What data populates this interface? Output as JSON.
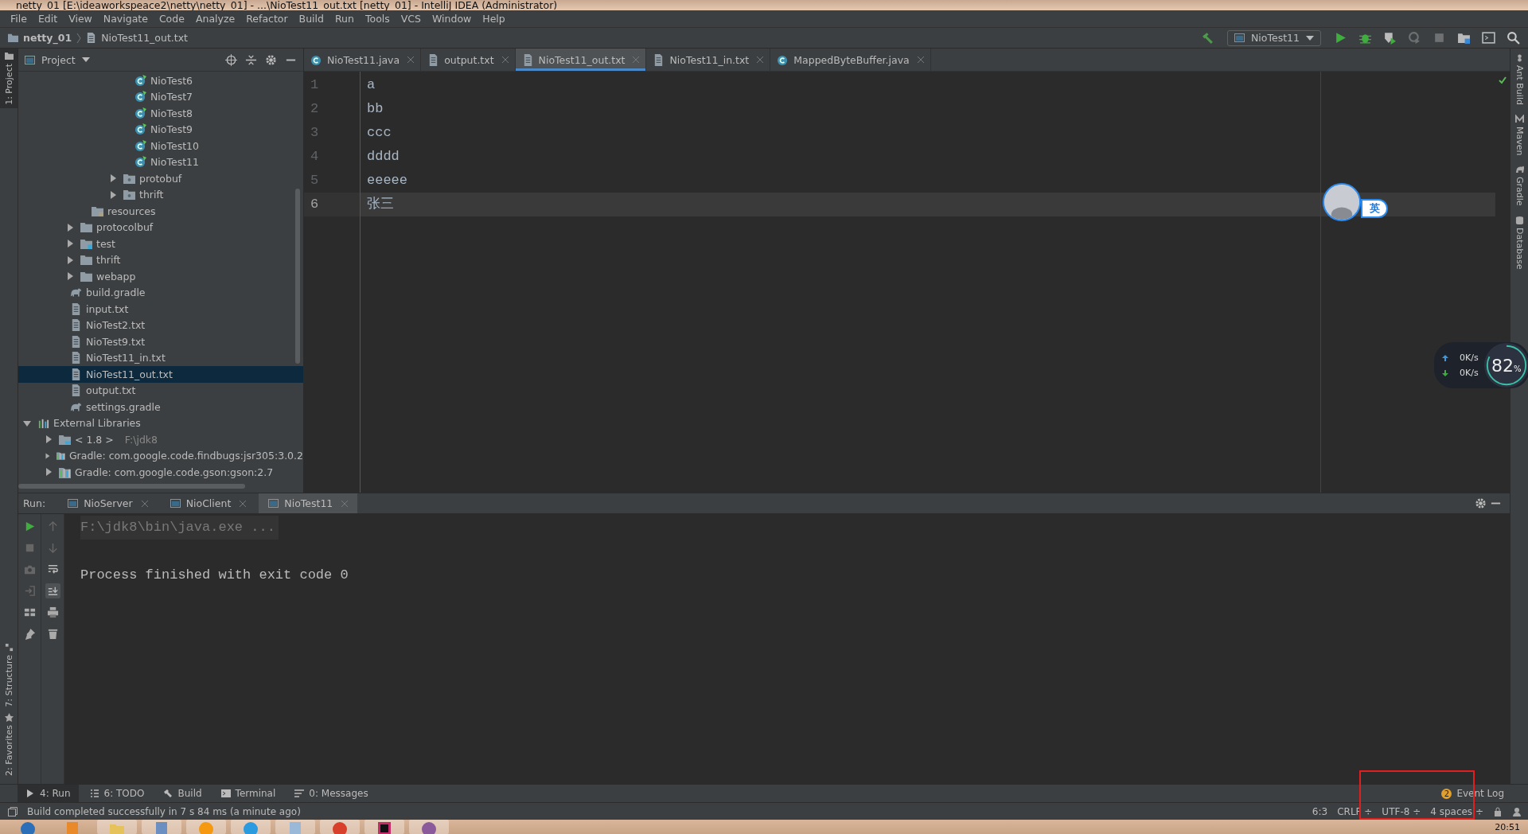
{
  "window": {
    "title": "netty_01 [E:\\ideaworkspeace2\\netty\\netty_01] - ...\\NioTest11_out.txt [netty_01] - IntelliJ IDEA (Administrator)"
  },
  "menu": [
    "File",
    "Edit",
    "View",
    "Navigate",
    "Code",
    "Analyze",
    "Refactor",
    "Build",
    "Run",
    "Tools",
    "VCS",
    "Window",
    "Help"
  ],
  "breadcrumb": [
    {
      "label": "netty_01",
      "kind": "project"
    },
    {
      "label": "NioTest11_out.txt",
      "kind": "file"
    }
  ],
  "toolbar": {
    "run_config": "NioTest11",
    "buttons": [
      {
        "kind": "build",
        "disabled": false
      },
      {
        "kind": "run",
        "disabled": false
      },
      {
        "kind": "debug",
        "disabled": false
      },
      {
        "kind": "coverage",
        "disabled": false
      },
      {
        "kind": "profile",
        "disabled": true
      },
      {
        "kind": "stop",
        "disabled": true
      },
      {
        "kind": "structure",
        "disabled": false
      },
      {
        "kind": "terminal",
        "disabled": false
      },
      {
        "kind": "search",
        "disabled": false
      }
    ]
  },
  "left_strip": [
    {
      "label": "1: Project",
      "selected": true,
      "kind": "project"
    },
    {
      "label": "7: Structure",
      "selected": false,
      "kind": "structure"
    },
    {
      "label": "2: Favorites",
      "selected": false,
      "kind": "favorites"
    }
  ],
  "project_panel": {
    "title": "Project",
    "tree": [
      {
        "children": [
          {
            "children": [
              {
                "children": [
                  {
                    "children": [
                      {
                        "children": [
                          {
                            "label": "NioTest6",
                            "kind": "class",
                            "selected": false
                          },
                          {
                            "label": "NioTest7",
                            "kind": "class",
                            "selected": false
                          },
                          {
                            "label": "NioTest8",
                            "kind": "class",
                            "selected": false
                          },
                          {
                            "label": "NioTest9",
                            "kind": "class",
                            "selected": false
                          },
                          {
                            "label": "NioTest10",
                            "kind": "class",
                            "selected": false
                          },
                          {
                            "label": "NioTest11",
                            "kind": "class",
                            "selected": false
                          }
                        ]
                      },
                      {
                        "label": "protobuf",
                        "kind": "package",
                        "expanded": false,
                        "selected": false
                      },
                      {
                        "label": "thrift",
                        "kind": "package",
                        "expanded": false,
                        "selected": false
                      }
                    ]
                  },
                  {
                    "label": "resources",
                    "kind": "resources",
                    "selected": false
                  }
                ]
              },
              {
                "label": "protocolbuf",
                "kind": "folder",
                "expanded": false,
                "selected": false
              },
              {
                "label": "test",
                "kind": "test",
                "expanded": false,
                "selected": false
              },
              {
                "label": "thrift",
                "kind": "folder",
                "expanded": false,
                "selected": false
              },
              {
                "label": "webapp",
                "kind": "folder",
                "expanded": false,
                "selected": false
              },
              {
                "label": "build.gradle",
                "kind": "gradle",
                "selected": false
              },
              {
                "label": "input.txt",
                "kind": "text",
                "selected": false
              },
              {
                "label": "NioTest2.txt",
                "kind": "text",
                "selected": false
              },
              {
                "label": "NioTest9.txt",
                "kind": "text",
                "selected": false
              },
              {
                "label": "NioTest11_in.txt",
                "kind": "text",
                "selected": false
              },
              {
                "label": "NioTest11_out.txt",
                "kind": "text",
                "selected": true
              },
              {
                "label": "output.txt",
                "kind": "text",
                "selected": false
              },
              {
                "label": "settings.gradle",
                "kind": "gradle",
                "selected": false
              }
            ]
          }
        ]
      },
      {
        "label": "External Libraries",
        "kind": "libraries",
        "expanded": true,
        "selected": false,
        "children": [
          {
            "label": "< 1.8 >",
            "hint": "F:\\jdk8",
            "kind": "jdk",
            "expanded": false,
            "selected": false
          },
          {
            "label": "Gradle: com.google.code.findbugs:jsr305:3.0.2",
            "kind": "library",
            "expanded": false,
            "selected": false
          },
          {
            "label": "Gradle: com.google.code.gson:gson:2.7",
            "kind": "library",
            "expanded": false,
            "selected": false
          }
        ]
      }
    ]
  },
  "editor": {
    "tabs": [
      {
        "label": "NioTest11.java",
        "kind": "java",
        "selected": false
      },
      {
        "label": "output.txt",
        "kind": "text",
        "selected": false
      },
      {
        "label": "NioTest11_out.txt",
        "kind": "text",
        "selected": true
      },
      {
        "label": "NioTest11_in.txt",
        "kind": "text",
        "selected": false
      },
      {
        "label": "MappedByteBuffer.java",
        "kind": "java",
        "selected": false
      }
    ],
    "lines": [
      {
        "number": "1",
        "text": "a",
        "selected": false
      },
      {
        "number": "2",
        "text": "bb",
        "selected": false
      },
      {
        "number": "3",
        "text": "ccc",
        "selected": false
      },
      {
        "number": "4",
        "text": "dddd",
        "selected": false
      },
      {
        "number": "5",
        "text": "eeeee",
        "selected": false
      },
      {
        "number": "6",
        "text": "张三",
        "selected": true
      }
    ]
  },
  "right_strip": [
    {
      "label": "Ant Build",
      "kind": "ant"
    },
    {
      "label": "Maven",
      "kind": "maven"
    },
    {
      "label": "Gradle",
      "kind": "gradle"
    },
    {
      "label": "Database",
      "kind": "database"
    }
  ],
  "run_panel": {
    "label": "Run:",
    "tabs": [
      {
        "label": "NioServer",
        "selected": false
      },
      {
        "label": "NioClient",
        "selected": false
      },
      {
        "label": "NioTest11",
        "selected": true
      }
    ],
    "output": [
      {
        "text": "F:\\jdk8\\bin\\java.exe ...",
        "kind": "command"
      },
      {
        "text": "Process finished with exit code 0",
        "kind": "normal"
      }
    ]
  },
  "tool_tabs": [
    {
      "label": "4: Run",
      "kind": "run",
      "selected": true
    },
    {
      "label": "6: TODO",
      "kind": "todo",
      "selected": false
    },
    {
      "label": "Build",
      "kind": "build",
      "selected": false
    },
    {
      "label": "Terminal",
      "kind": "terminal",
      "selected": false
    },
    {
      "label": "0: Messages",
      "kind": "messages",
      "selected": false
    }
  ],
  "event_log": {
    "label": "Event Log",
    "count": "2"
  },
  "status_bar": {
    "message": "Build completed successfully in 7 s 84 ms (a minute ago)",
    "position": "6:3",
    "line_separator": "CRLF ÷",
    "encoding": "UTF-8 ÷",
    "indent": "4 spaces ÷"
  },
  "overlays": {
    "ime": "英",
    "upload": "0K/s",
    "download": "0K/s",
    "memory": "82",
    "memory_unit": "%"
  },
  "taskbar": {
    "clock": "20:51",
    "apps": [
      {
        "kind": "start"
      },
      {
        "kind": "media"
      },
      {
        "kind": "explorer"
      },
      {
        "kind": "window"
      },
      {
        "kind": "orange"
      },
      {
        "kind": "browser"
      },
      {
        "kind": "notepad"
      },
      {
        "kind": "chrome"
      },
      {
        "kind": "ide"
      },
      {
        "kind": "sphere"
      }
    ]
  }
}
